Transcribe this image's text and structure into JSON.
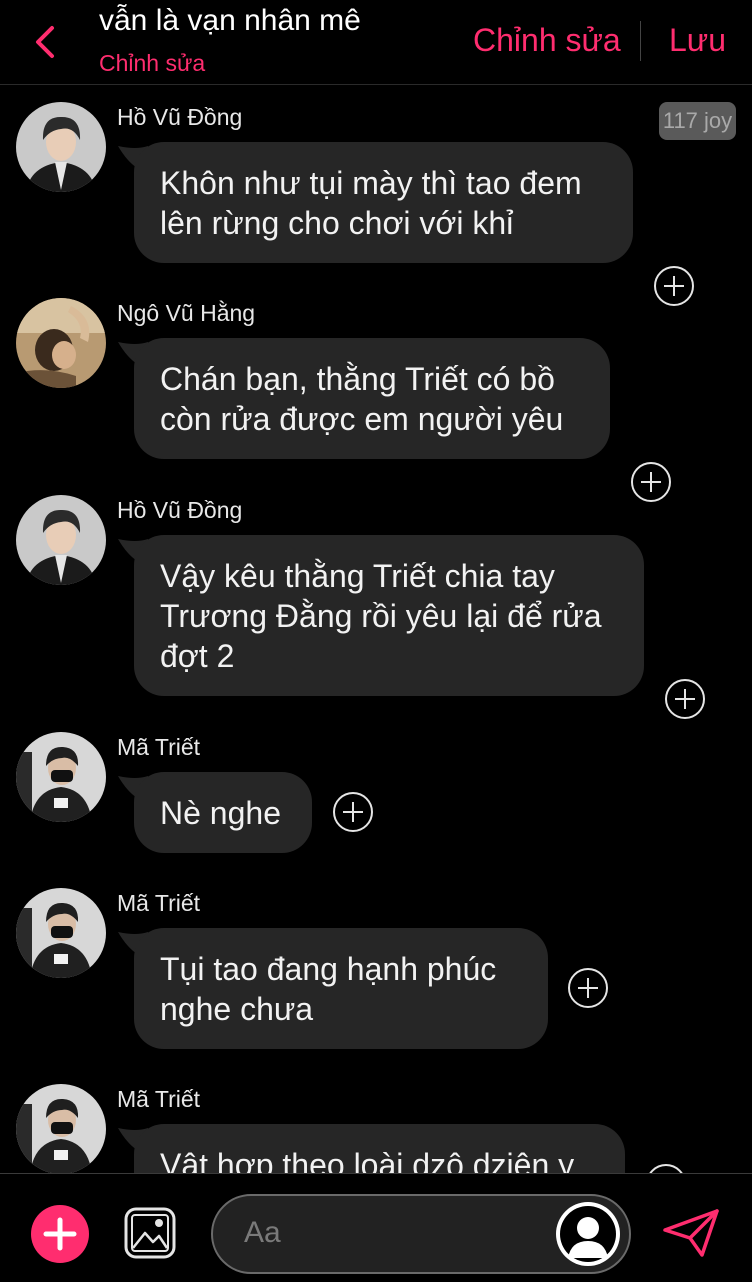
{
  "header": {
    "title": "vẫn là vạn nhân mê",
    "subtitle": "Chỉnh sửa",
    "edit_label": "Chỉnh sửa",
    "save_label": "Lưu",
    "accent": "#ff2d6f"
  },
  "badge": {
    "text": "117 joy"
  },
  "messages": [
    {
      "sender": "Hồ Vũ Đồng",
      "lines": [
        "Khôn như tụi mày thì tao đem",
        "lên rừng cho chơi với khỉ"
      ]
    },
    {
      "sender": "Ngô Vũ Hằng",
      "lines": [
        "Chán bạn, thằng Triết có bồ",
        "còn rửa được em người yêu"
      ]
    },
    {
      "sender": "Hồ Vũ Đồng",
      "lines": [
        "Vậy kêu thằng Triết chia tay",
        "Trương Đằng rồi yêu lại để rửa",
        "đợt 2"
      ]
    },
    {
      "sender": "Mã Triết",
      "lines": [
        "Nè nghe"
      ]
    },
    {
      "sender": "Mã Triết",
      "lines": [
        "Tụi tao đang hạnh phúc",
        "nghe chưa"
      ]
    },
    {
      "sender": "Mã Triết",
      "lines": [
        "Vật hợp theo loài dzô dziên y"
      ]
    }
  ],
  "composer": {
    "placeholder": "Aa"
  },
  "icons": {
    "back": "chevron-left-icon",
    "add": "plus-icon",
    "gallery": "image-icon",
    "send": "send-icon",
    "react": "plus-circle-icon"
  }
}
